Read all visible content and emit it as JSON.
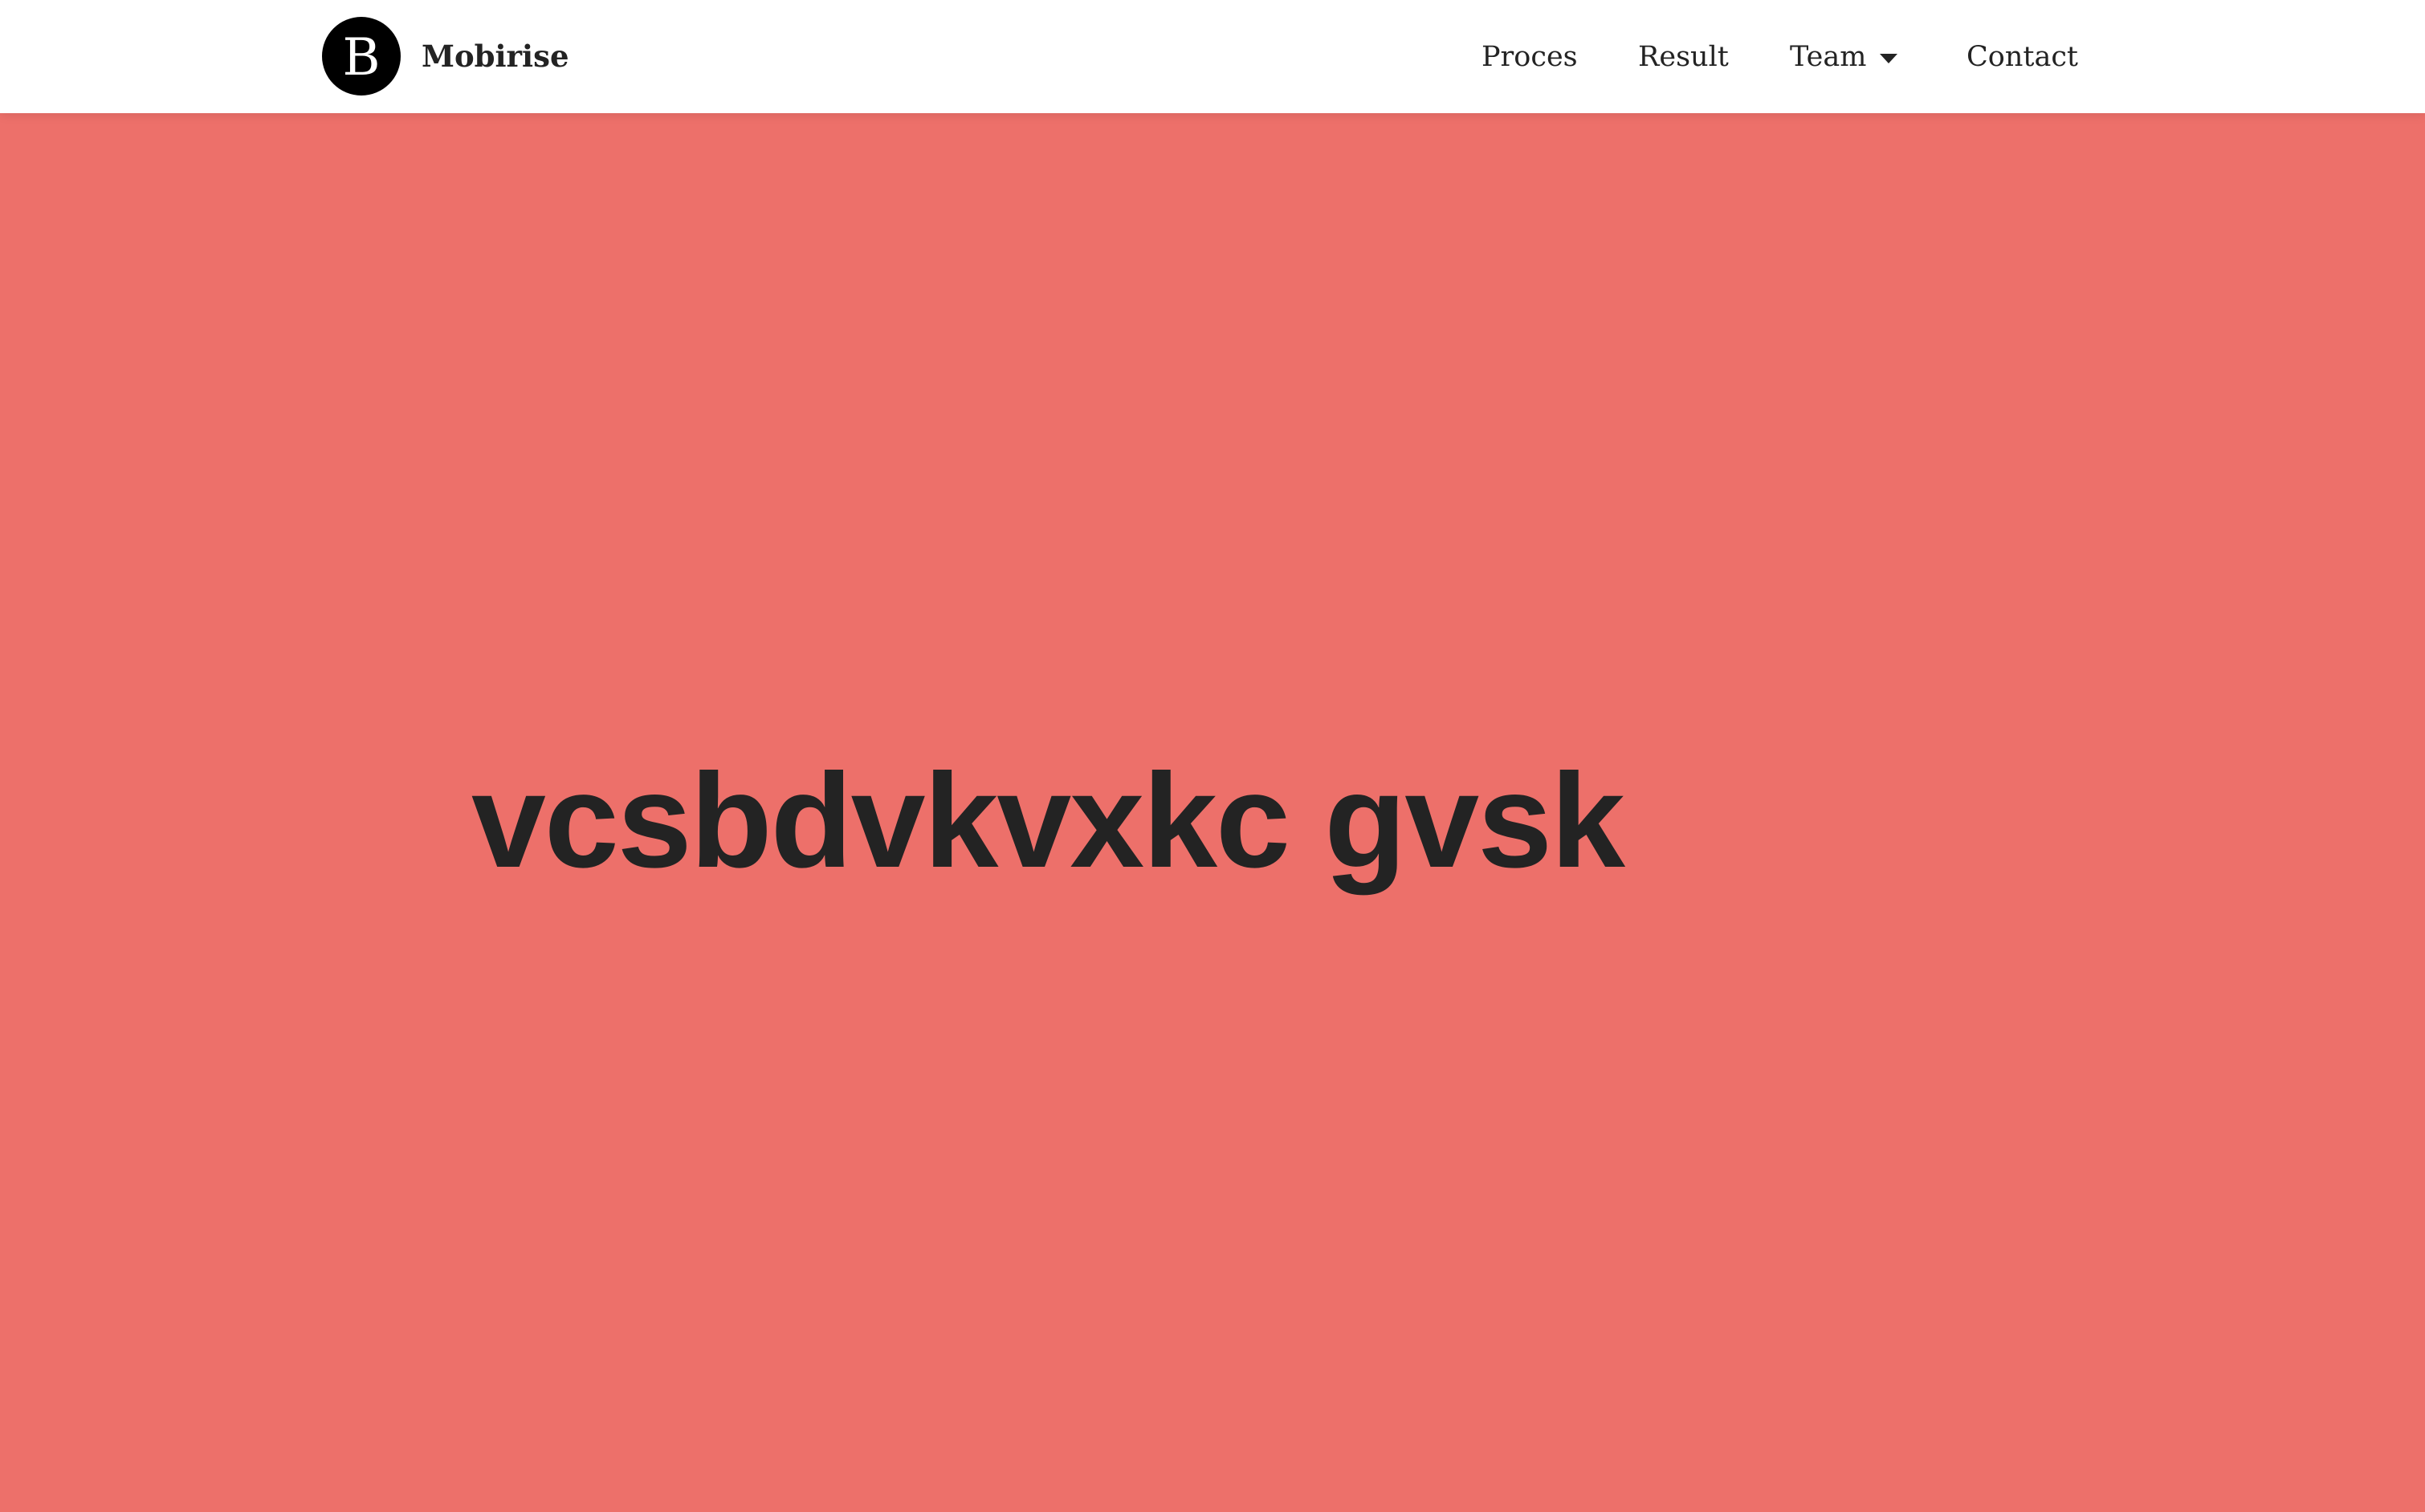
{
  "navbar": {
    "brand": {
      "logo_letter": "B",
      "name": "Mobirise"
    },
    "menu": [
      {
        "label": "Proces"
      },
      {
        "label": "Result"
      },
      {
        "label": "Team",
        "has_dropdown": true,
        "icon": "caret-down-icon"
      },
      {
        "label": "Contact"
      }
    ]
  },
  "hero": {
    "title": "vcsbdvkvxkc gvsk"
  },
  "colors": {
    "navbar_background": "#ffffff",
    "hero_background": "#ed706a",
    "text": "#232323",
    "logo_background": "#000000"
  }
}
